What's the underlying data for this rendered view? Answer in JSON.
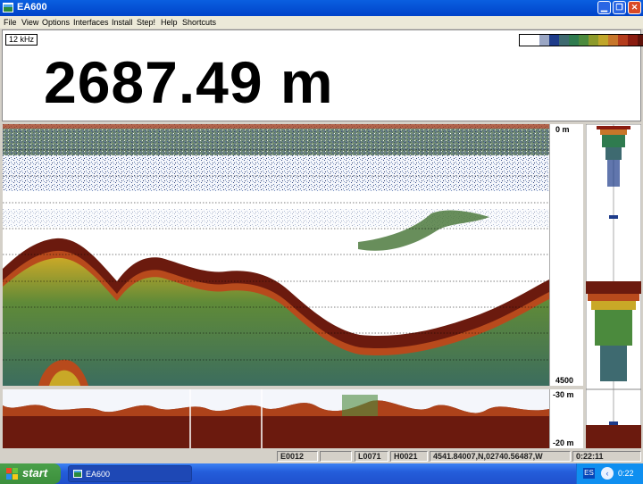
{
  "window": {
    "title": "EA600",
    "minimize_icon": "minimize-icon",
    "maximize_icon": "restore-icon",
    "close_icon": "close-icon"
  },
  "menu": {
    "items": [
      "File",
      "View",
      "Options",
      "Interfaces",
      "Install",
      "Step!",
      "Help",
      "Shortcuts"
    ]
  },
  "depth_panel": {
    "frequency": "12 kHz",
    "depth": "2687.49 m",
    "palette": [
      "#ffffff",
      "#9aa6c4",
      "#1e3c8a",
      "#3e6a70",
      "#2f7b4f",
      "#4b8a3d",
      "#8c9a2b",
      "#c0a62a",
      "#c7762a",
      "#b43c1c",
      "#8a1c10",
      "#5e120a"
    ]
  },
  "echogram": {
    "scale_top": "0 m",
    "scale_bottom": "4500"
  },
  "bottom_panel": {
    "scale_top": "-30 m",
    "scale_bottom": "-20 m"
  },
  "status": {
    "field1": "E0012",
    "field2": "L0071",
    "field3": "H0021",
    "position": "4541.84007,N,02740.56487,W",
    "time": "0:22:11"
  },
  "taskbar": {
    "start_label": "start",
    "task_label": "EA600",
    "lang": "ES",
    "clock": "0:22"
  }
}
